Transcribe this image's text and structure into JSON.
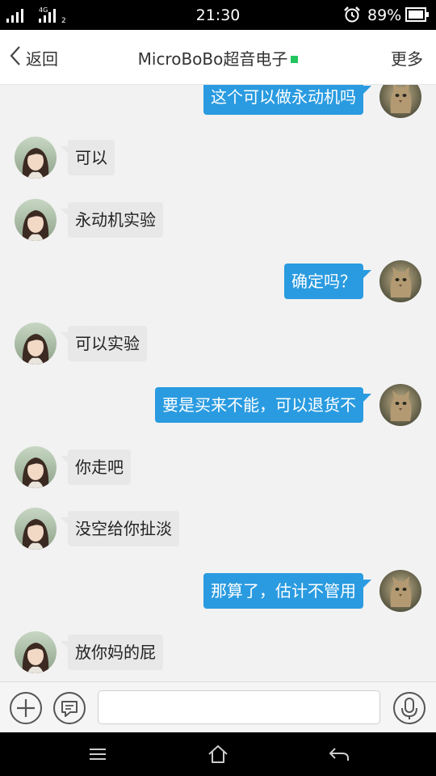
{
  "status_bar": {
    "network": "4G",
    "sim2": "2",
    "time": "21:30",
    "battery": "89%"
  },
  "header": {
    "back_label": "返回",
    "title": "MicroBoBo超音电子",
    "more_label": "更多",
    "online_color": "#22c55e"
  },
  "messages": [
    {
      "side": "out",
      "text": "这个可以做永动机吗"
    },
    {
      "side": "in",
      "text": "可以"
    },
    {
      "side": "in",
      "text": "永动机实验"
    },
    {
      "side": "out",
      "text": "确定吗？"
    },
    {
      "side": "in",
      "text": "可以实验"
    },
    {
      "side": "out",
      "text": "要是买来不能，可以退货不"
    },
    {
      "side": "in",
      "text": "你走吧"
    },
    {
      "side": "in",
      "text": "没空给你扯淡"
    },
    {
      "side": "out",
      "text": "那算了，估计不管用"
    },
    {
      "side": "in",
      "text": "放你妈的屁"
    }
  ],
  "input": {
    "placeholder": "",
    "value": ""
  },
  "colors": {
    "outgoing_bubble": "#2a9be0",
    "incoming_bubble": "#e8e8e8"
  }
}
